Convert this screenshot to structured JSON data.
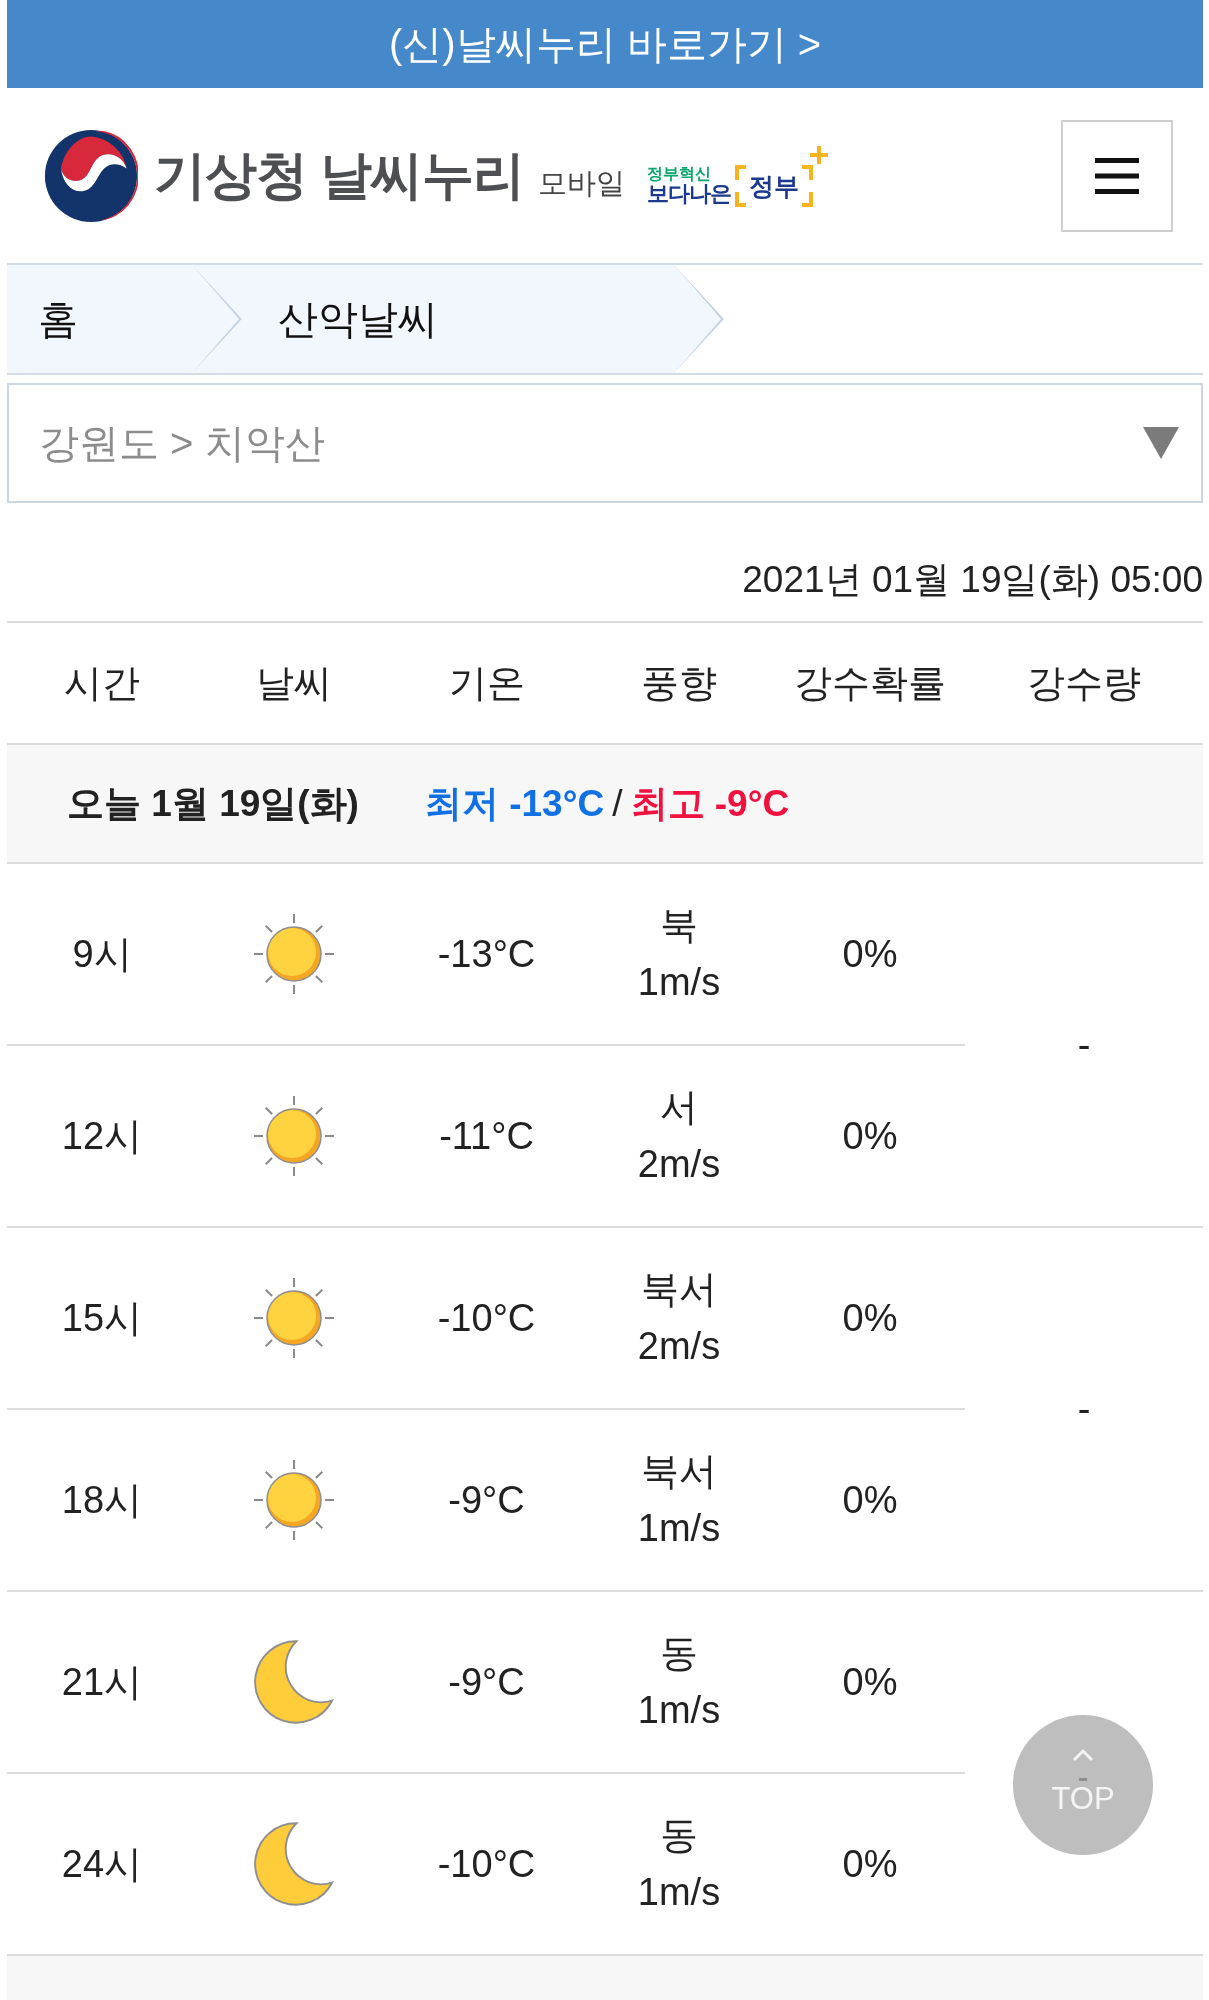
{
  "banner": {
    "text": "(신)날씨누리 바로가기 >"
  },
  "header": {
    "title": "기상청 날씨누리",
    "subtitle": "모바일",
    "gov_logo": {
      "tagline": "정부혁신",
      "slogan": "보다나은",
      "word": "정부"
    }
  },
  "breadcrumb": [
    {
      "label": "홈"
    },
    {
      "label": "산악날씨"
    }
  ],
  "location_select": {
    "value": "강원도 > 치악산"
  },
  "issued": "2021년 01월 19일(화) 05:00",
  "table": {
    "columns": [
      "시간",
      "날씨",
      "기온",
      "풍향",
      "강수확률",
      "강수량"
    ],
    "days": [
      {
        "label": "오늘 1월 19일(화)",
        "min": "최저 -13°C",
        "separator": "/",
        "max": "최고 -9°C",
        "groups": [
          {
            "rainfall": "-",
            "rows": [
              {
                "time": "9시",
                "kind": "day",
                "temperature": "-13°C",
                "wind_direction": "북",
                "wind_speed": "1m/s",
                "precip_chance": "0%"
              },
              {
                "time": "12시",
                "kind": "day",
                "temperature": "-11°C",
                "wind_direction": "서",
                "wind_speed": "2m/s",
                "precip_chance": "0%"
              }
            ]
          },
          {
            "rainfall": "-",
            "rows": [
              {
                "time": "15시",
                "kind": "day",
                "temperature": "-10°C",
                "wind_direction": "북서",
                "wind_speed": "2m/s",
                "precip_chance": "0%"
              },
              {
                "time": "18시",
                "kind": "day",
                "temperature": "-9°C",
                "wind_direction": "북서",
                "wind_speed": "1m/s",
                "precip_chance": "0%"
              }
            ]
          },
          {
            "rows": [
              {
                "time": "21시",
                "kind": "night",
                "temperature": "-9°C",
                "wind_direction": "동",
                "wind_speed": "1m/s",
                "precip_chance": "0%"
              },
              {
                "time": "24시",
                "kind": "night",
                "temperature": "-10°C",
                "wind_direction": "동",
                "wind_speed": "1m/s",
                "precip_chance": "0%"
              }
            ]
          }
        ]
      }
    ]
  },
  "top_button": {
    "label": "TOP"
  }
}
